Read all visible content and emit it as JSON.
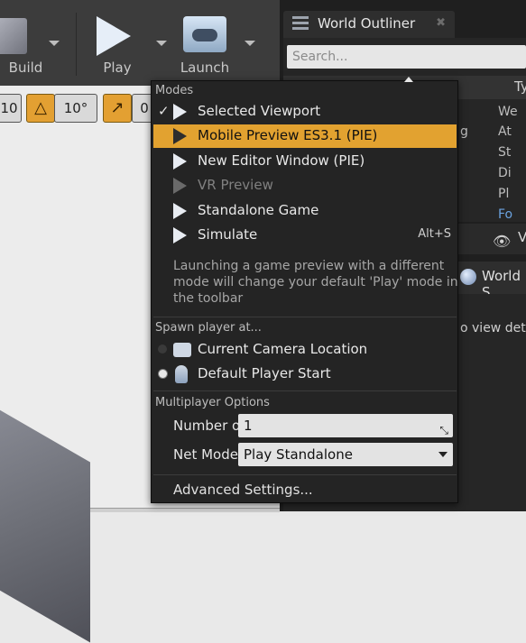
{
  "toolbar": {
    "build_label": "Build",
    "play_label": "Play",
    "launch_label": "Launch"
  },
  "snapbar": {
    "grid_value": "10",
    "rotation_value": "10°",
    "scale_value": "0"
  },
  "outliner": {
    "tab_title": "World Outliner",
    "search_placeholder": "Search...",
    "type_header": "Ty",
    "rows": [
      "We",
      "At",
      "St",
      "Di",
      "Pl"
    ],
    "left_row": "g",
    "link_text": "Fo"
  },
  "view_options": {
    "label": "V"
  },
  "details": {
    "tab_title": "World S",
    "hint": "o view deta"
  },
  "menu": {
    "modes_header": "Modes",
    "items": [
      {
        "label": "Selected Viewport",
        "checked": true,
        "selected": false,
        "disabled": false,
        "shortcut": ""
      },
      {
        "label": "Mobile Preview ES3.1 (PIE)",
        "checked": false,
        "selected": true,
        "disabled": false,
        "shortcut": ""
      },
      {
        "label": "New Editor Window (PIE)",
        "checked": false,
        "selected": false,
        "disabled": false,
        "shortcut": ""
      },
      {
        "label": "VR Preview",
        "checked": false,
        "selected": false,
        "disabled": true,
        "shortcut": ""
      },
      {
        "label": "Standalone Game",
        "checked": false,
        "selected": false,
        "disabled": false,
        "shortcut": ""
      },
      {
        "label": "Simulate",
        "checked": false,
        "selected": false,
        "disabled": false,
        "shortcut": "Alt+S"
      }
    ],
    "description": "Launching a game preview with a different mode will change your default 'Play' mode in the toolbar",
    "spawn_header": "Spawn player at...",
    "spawn_options": [
      {
        "label": "Current Camera Location",
        "selected": false
      },
      {
        "label": "Default Player Start",
        "selected": true
      }
    ],
    "multiplayer_header": "Multiplayer Options",
    "num_players_label": "Number of Players",
    "num_players_value": "1",
    "net_mode_label": "Net Mode",
    "net_mode_value": "Play Standalone",
    "advanced_label": "Advanced Settings..."
  },
  "colors": {
    "highlight": "#e2a230",
    "menu_bg": "#242424",
    "panel_bg": "#262626"
  }
}
